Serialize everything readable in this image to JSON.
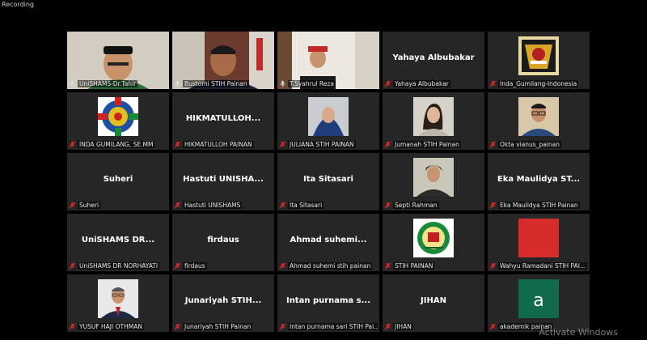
{
  "recording_label": "Recording",
  "watermark": "Activate Windows",
  "colors": {
    "active_speaker_border": "#b7c934",
    "muted_icon": "#e02828"
  },
  "participants": [
    {
      "label": "UniSHAMS-Dr.Tahir",
      "tile_text": "",
      "video": "man-peci",
      "muted": false,
      "active": false
    },
    {
      "label": "Bustomi STIH Painan",
      "tile_text": "",
      "video": "man-office",
      "muted": false,
      "active": false
    },
    {
      "label": "T.Syahrul Reza",
      "tile_text": "",
      "video": "boy-cap",
      "muted": false,
      "active": true
    },
    {
      "label": "Yahaya Albubakar",
      "tile_text": "Yahaya Albubakar",
      "video": "",
      "muted": true,
      "active": false
    },
    {
      "label": "Inda_Gumilang-Indonesia",
      "tile_text": "",
      "video": "avatar-emblem",
      "muted": true,
      "active": false
    },
    {
      "label": "INDA GUMILANG, SE.MM",
      "tile_text": "",
      "video": "avatar-flags",
      "muted": true,
      "active": false
    },
    {
      "label": "HIKMATULLOH PAINAN",
      "tile_text": "HIKMATULLOH...",
      "video": "",
      "muted": true,
      "active": false
    },
    {
      "label": "JULIANA STIH PAINAN",
      "tile_text": "",
      "video": "avatar-hijab",
      "muted": true,
      "active": false
    },
    {
      "label": "Jumanah STIH Painan",
      "tile_text": "",
      "video": "avatar-woman",
      "muted": true,
      "active": false
    },
    {
      "label": "Okta vianus_painan",
      "tile_text": "",
      "video": "avatar-man-glasses",
      "muted": true,
      "active": false
    },
    {
      "label": "Suheri",
      "tile_text": "Suheri",
      "video": "",
      "muted": true,
      "active": false
    },
    {
      "label": "Hastuti UNISHAMS",
      "tile_text": "Hastuti UNISHA...",
      "video": "",
      "muted": true,
      "active": false
    },
    {
      "label": "Ita Sitasari",
      "tile_text": "Ita Sitasari",
      "video": "",
      "muted": true,
      "active": false
    },
    {
      "label": "Septi Rahman",
      "tile_text": "",
      "video": "avatar-young-man",
      "muted": true,
      "active": false
    },
    {
      "label": "Eka Maulidya STIH Painan",
      "tile_text": "Eka Maulidya ST...",
      "video": "",
      "muted": true,
      "active": false
    },
    {
      "label": "UniSHAMS DR NORHAYATI",
      "tile_text": "UniSHAMS DR...",
      "video": "",
      "muted": true,
      "active": false
    },
    {
      "label": "firdaus",
      "tile_text": "firdaus",
      "video": "",
      "muted": true,
      "active": false
    },
    {
      "label": "Ahmad suhemi stih painan",
      "tile_text": "Ahmad suhemi...",
      "video": "",
      "muted": true,
      "active": false
    },
    {
      "label": "STIH PAINAN",
      "tile_text": "",
      "video": "avatar-logo",
      "muted": true,
      "active": false
    },
    {
      "label": "Wahyu Ramadani STIH PAI...",
      "tile_text": "",
      "video": "avatar-red",
      "muted": true,
      "active": false
    },
    {
      "label": "YUSUF HAJI OTHMAN",
      "tile_text": "",
      "video": "avatar-man-suit",
      "muted": true,
      "active": false
    },
    {
      "label": "Junariyah STIH Painan",
      "tile_text": "Junariyah STIH...",
      "video": "",
      "muted": true,
      "active": false
    },
    {
      "label": "Intan purnama sari STIH Pai...",
      "tile_text": "Intan purnama s...",
      "video": "",
      "muted": true,
      "active": false
    },
    {
      "label": "JIHAN",
      "tile_text": "JIHAN",
      "video": "",
      "muted": true,
      "active": false
    },
    {
      "label": "akademik painan",
      "tile_text": "",
      "video": "avatar-letter-a",
      "muted": true,
      "active": false
    }
  ],
  "avatar_letter": "a"
}
